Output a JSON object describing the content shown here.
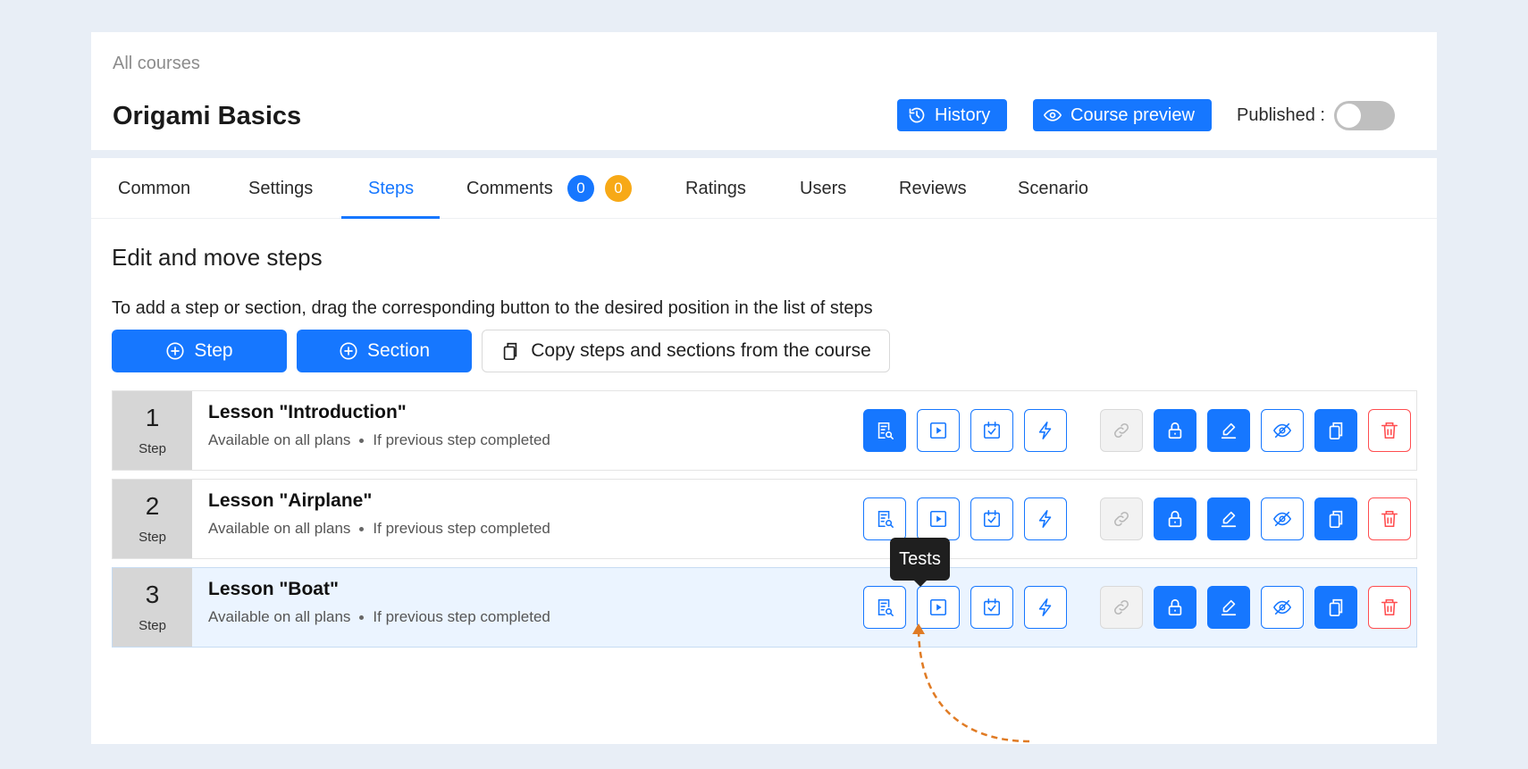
{
  "header": {
    "breadcrumb": "All courses",
    "title": "Origami Basics",
    "history_label": "History",
    "preview_label": "Course preview",
    "published_label": "Published :",
    "published": false
  },
  "tabs": [
    {
      "label": "Common"
    },
    {
      "label": "Settings"
    },
    {
      "label": "Steps"
    },
    {
      "label": "Comments"
    },
    {
      "label": "Ratings"
    },
    {
      "label": "Users"
    },
    {
      "label": "Reviews"
    },
    {
      "label": "Scenario"
    }
  ],
  "active_tab": "Steps",
  "comments_badges": {
    "blue": "0",
    "orange": "0"
  },
  "steps_page": {
    "title": "Edit and move steps",
    "hint": "To add a step or section, drag the corresponding button to the desired position in the list of steps",
    "add_step_label": "Step",
    "add_section_label": "Section",
    "copy_label": "Copy steps and sections from the course"
  },
  "steps": [
    {
      "number": "1",
      "unit": "Step",
      "title": "Lesson \"Introduction\"",
      "availability": "Available on all plans",
      "condition": "If previous step completed"
    },
    {
      "number": "2",
      "unit": "Step",
      "title": "Lesson \"Airplane\"",
      "availability": "Available on all plans",
      "condition": "If previous step completed"
    },
    {
      "number": "3",
      "unit": "Step",
      "title": "Lesson \"Boat\"",
      "availability": "Available on all plans",
      "condition": "If previous step completed"
    }
  ],
  "tooltip": "Tests",
  "colors": {
    "accent": "#1677ff",
    "badge_orange": "#f7a917",
    "danger": "#ff4d4f",
    "annotation_arrow": "#e07b24",
    "highlight_row": "#ebf4ff"
  },
  "row_actions": [
    "lesson-preview-icon",
    "tests-play-icon",
    "assignment-calendar-icon",
    "lightning-icon",
    "link-icon",
    "lock-icon",
    "edit-pen-icon",
    "eye-off-icon",
    "copy-icon",
    "trash-icon"
  ]
}
